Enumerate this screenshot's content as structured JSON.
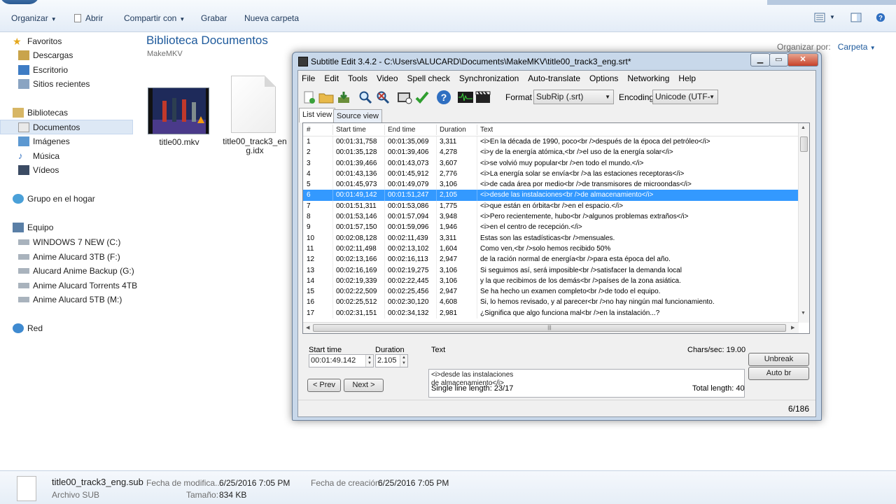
{
  "explorer": {
    "toolbar": {
      "organize": "Organizar",
      "open": "Abrir",
      "share": "Compartir con",
      "burn": "Grabar",
      "new_folder": "Nueva carpeta"
    },
    "nav": {
      "favorites": "Favoritos",
      "downloads": "Descargas",
      "desktop": "Escritorio",
      "recent": "Sitios recientes",
      "libraries": "Bibliotecas",
      "documents": "Documentos",
      "images": "Imágenes",
      "music": "Música",
      "videos": "Vídeos",
      "homegroup": "Grupo en el hogar",
      "computer": "Equipo",
      "drives": [
        "WINDOWS 7 NEW (C:)",
        "Anime Alucard 3TB (F:)",
        "Alucard Anime Backup (G:)",
        "Anime Alucard Torrents 4TB",
        "Anime Alucard 5TB (M:)"
      ],
      "network": "Red"
    },
    "library_title": "Biblioteca Documentos",
    "library_sub": "MakeMKV",
    "arrange_label": "Organizar por:",
    "arrange_value": "Carpeta",
    "files": [
      {
        "name": "title00.mkv"
      },
      {
        "name_line1": "title00_track3_en",
        "name_line2": "g.idx"
      }
    ],
    "details": {
      "filename": "title00_track3_eng.sub",
      "filetype": "Archivo SUB",
      "modified_label": "Fecha de modifica...",
      "modified_value": "6/25/2016 7:05 PM",
      "size_label": "Tamaño:",
      "size_value": "834 KB",
      "created_label": "Fecha de creación:",
      "created_value": "6/25/2016 7:05 PM"
    }
  },
  "subtitle_edit": {
    "title": "Subtitle Edit 3.4.2 - C:\\Users\\ALUCARD\\Documents\\MakeMKV\\title00_track3_eng.srt*",
    "menu": [
      "File",
      "Edit",
      "Tools",
      "Video",
      "Spell check",
      "Synchronization",
      "Auto-translate",
      "Options",
      "Networking",
      "Help"
    ],
    "format_label": "Format",
    "format_value": "SubRip (.srt)",
    "encoding_label": "Encoding",
    "encoding_value": "Unicode (UTF-",
    "tabs": [
      "List view",
      "Source view"
    ],
    "columns": [
      "#",
      "Start time",
      "End time",
      "Duration",
      "Text"
    ],
    "rows": [
      [
        "1",
        "00:01:31,758",
        "00:01:35,069",
        "3,311",
        "<i>En la década de 1990, poco<br />después de la época del petróleo</i>"
      ],
      [
        "2",
        "00:01:35,128",
        "00:01:39,406",
        "4,278",
        "<i>y de la energía atómica,<br />el uso de la energía solar</i>"
      ],
      [
        "3",
        "00:01:39,466",
        "00:01:43,073",
        "3,607",
        "<i>se volvió muy popular<br />en todo el mundo.</i>"
      ],
      [
        "4",
        "00:01:43,136",
        "00:01:45,912",
        "2,776",
        "<i>La energía solar se envía<br />a las estaciones receptoras</i>"
      ],
      [
        "5",
        "00:01:45,973",
        "00:01:49,079",
        "3,106",
        "<i>de cada área por medio<br />de transmisores de microondas</i>"
      ],
      [
        "6",
        "00:01:49,142",
        "00:01:51,247",
        "2,105",
        "<i>desde las instalaciones<br />de almacenamiento</i>"
      ],
      [
        "7",
        "00:01:51,311",
        "00:01:53,086",
        "1,775",
        "<i>que están en órbita<br />en el espacio.</i>"
      ],
      [
        "8",
        "00:01:53,146",
        "00:01:57,094",
        "3,948",
        "<i>Pero recientemente, hubo<br />algunos problemas extraños</i>"
      ],
      [
        "9",
        "00:01:57,150",
        "00:01:59,096",
        "1,946",
        "<i>en el centro de recepción.</i>"
      ],
      [
        "10",
        "00:02:08,128",
        "00:02:11,439",
        "3,311",
        "Estas son las estadísticas<br />mensuales."
      ],
      [
        "11",
        "00:02:11,498",
        "00:02:13,102",
        "1,604",
        "Como ven,<br />solo hemos recibido 50%"
      ],
      [
        "12",
        "00:02:13,166",
        "00:02:16,113",
        "2,947",
        "de la ración normal de energía<br />para esta época del año."
      ],
      [
        "13",
        "00:02:16,169",
        "00:02:19,275",
        "3,106",
        "Si seguimos así, será imposible<br />satisfacer la demanda local"
      ],
      [
        "14",
        "00:02:19,339",
        "00:02:22,445",
        "3,106",
        "y la que recibimos de los demás<br />países de la zona asiática."
      ],
      [
        "15",
        "00:02:22,509",
        "00:02:25,456",
        "2,947",
        "Se ha hecho un examen completo<br />de todo el equipo."
      ],
      [
        "16",
        "00:02:25,512",
        "00:02:30,120",
        "4,608",
        "Si, lo hemos revisado, y al parecer<br />no hay ningún mal funcionamiento."
      ],
      [
        "17",
        "00:02:31,151",
        "00:02:34,132",
        "2,981",
        "¿Significa que algo funciona mal<br />en la instalación...?"
      ]
    ],
    "selected_row": 5,
    "editor": {
      "start_label": "Start time",
      "start_value": "00:01:49.142",
      "duration_label": "Duration",
      "duration_value": "2.105",
      "text_label": "Text",
      "chars_sec": "Chars/sec: 19.00",
      "text_line1": "<i>desde las instalaciones",
      "text_line2": "de almacenamiento</i>",
      "unbreak": "Unbreak",
      "auto_br": "Auto br",
      "prev": "< Prev",
      "next": "Next >",
      "single_line": "Single line length: 23/17",
      "total_length": "Total length: 40"
    },
    "status_count": "6/186"
  },
  "colors": {
    "selection": "#3399ff",
    "library_title": "#1e5a9c",
    "window_frame": "#c8d8ea"
  }
}
